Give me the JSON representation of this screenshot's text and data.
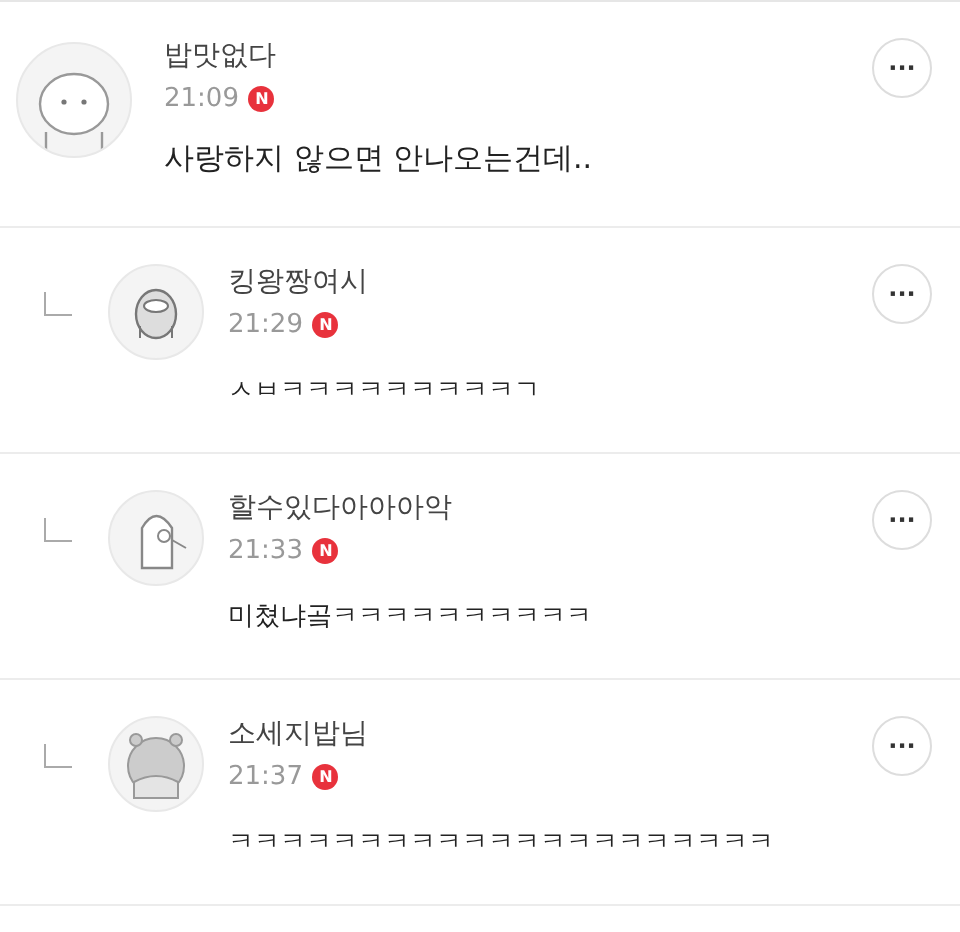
{
  "comments": [
    {
      "kind": "comment",
      "author": "밥맛없다",
      "time": "21:09",
      "badge": "N",
      "text": "사랑하지 않으면 안나오는건데..",
      "more": "···"
    },
    {
      "kind": "reply",
      "author": "킹왕짱여시",
      "time": "21:29",
      "badge": "N",
      "text": "ㅅㅂㅋㅋㅋㅋㅋㅋㅋㅋㅋㄱ",
      "more": "···"
    },
    {
      "kind": "reply",
      "author": "할수있다아아아악",
      "time": "21:33",
      "badge": "N",
      "text": "미쳤냐곸ㅋㅋㅋㅋㅋㅋㅋㅋㅋㅋ",
      "more": "···"
    },
    {
      "kind": "reply",
      "author": "소세지밥님",
      "time": "21:37",
      "badge": "N",
      "text": "ㅋㅋㅋㅋㅋㅋㅋㅋㅋㅋㅋㅋㅋㅋㅋㅋㅋㅋㅋㅋㅋ",
      "more": "···"
    }
  ]
}
